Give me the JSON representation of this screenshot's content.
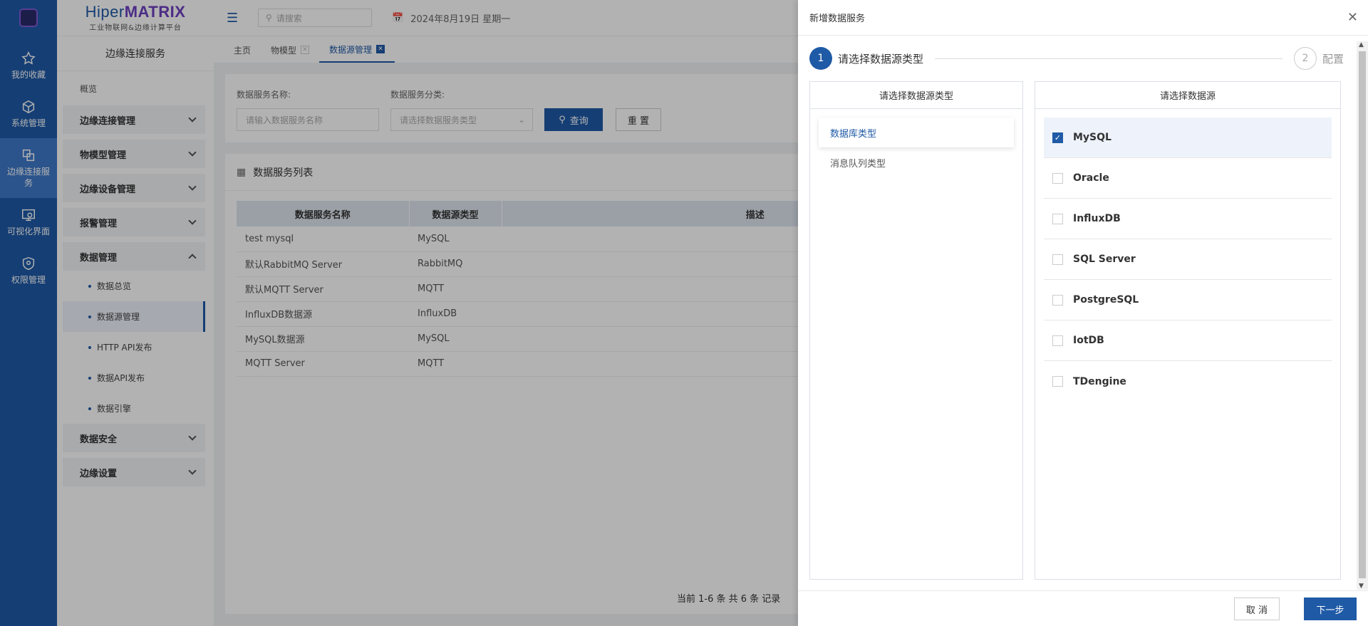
{
  "rail": {
    "items": [
      {
        "label": "我的收藏",
        "icon": "star-icon"
      },
      {
        "label": "系统管理",
        "icon": "cube-icon"
      },
      {
        "label": "边缘连接服务",
        "icon": "connect-icon"
      },
      {
        "label": "可视化界面",
        "icon": "screen-icon"
      },
      {
        "label": "权限管理",
        "icon": "shield-icon"
      }
    ]
  },
  "brand": {
    "name_a": "Hiper",
    "name_b": "MATRIX",
    "subtitle": "工业物联网&边缘计算平台"
  },
  "sidebar": {
    "title": "边缘连接服务",
    "overview": "概览",
    "groups": [
      "边缘连接管理",
      "物模型管理",
      "边缘设备管理",
      "报警管理",
      "数据管理"
    ],
    "sub_items": [
      "数据总览",
      "数据源管理",
      "HTTP API发布",
      "数据API发布",
      "数据引擎"
    ],
    "groups_after": [
      "数据安全",
      "边缘设置"
    ]
  },
  "topbar": {
    "search_placeholder": "请搜索",
    "date": "2024年8月19日 星期一"
  },
  "tabs": [
    "主页",
    "物模型",
    "数据源管理"
  ],
  "filter": {
    "name_label": "数据服务名称:",
    "name_placeholder": "请输入数据服务名称",
    "type_label": "数据服务分类:",
    "type_placeholder": "请选择数据服务类型",
    "query": "查询",
    "reset": "重 置"
  },
  "list": {
    "title": "数据服务列表",
    "columns": [
      "数据服务名称",
      "数据源类型",
      "描述"
    ],
    "rows": [
      [
        "test mysql",
        "MySQL",
        ""
      ],
      [
        "默认RabbitMQ Server",
        "RabbitMQ",
        ""
      ],
      [
        "默认MQTT Server",
        "MQTT",
        ""
      ],
      [
        "InfluxDB数据源",
        "InfluxDB",
        ""
      ],
      [
        "MySQL数据源",
        "MySQL",
        ""
      ],
      [
        "MQTT Server",
        "MQTT",
        ""
      ]
    ],
    "pager": "当前 1-6 条 共 6 条 记录"
  },
  "drawer": {
    "title": "新增数据服务",
    "step1_num": "1",
    "step1_label": "请选择数据源类型",
    "step2_num": "2",
    "step2_label": "配置",
    "left_header": "请选择数据源类型",
    "right_header": "请选择数据源",
    "types": [
      "数据库类型",
      "消息队列类型"
    ],
    "sources": [
      "MySQL",
      "Oracle",
      "InfluxDB",
      "SQL Server",
      "PostgreSQL",
      "IotDB",
      "TDengine"
    ],
    "selected_source": "MySQL",
    "cancel": "取 消",
    "next": "下一步"
  },
  "colors": {
    "primary": "#1f5aa6",
    "rail": "#1f5aa6",
    "brand_accent": "#6d3fc0"
  }
}
